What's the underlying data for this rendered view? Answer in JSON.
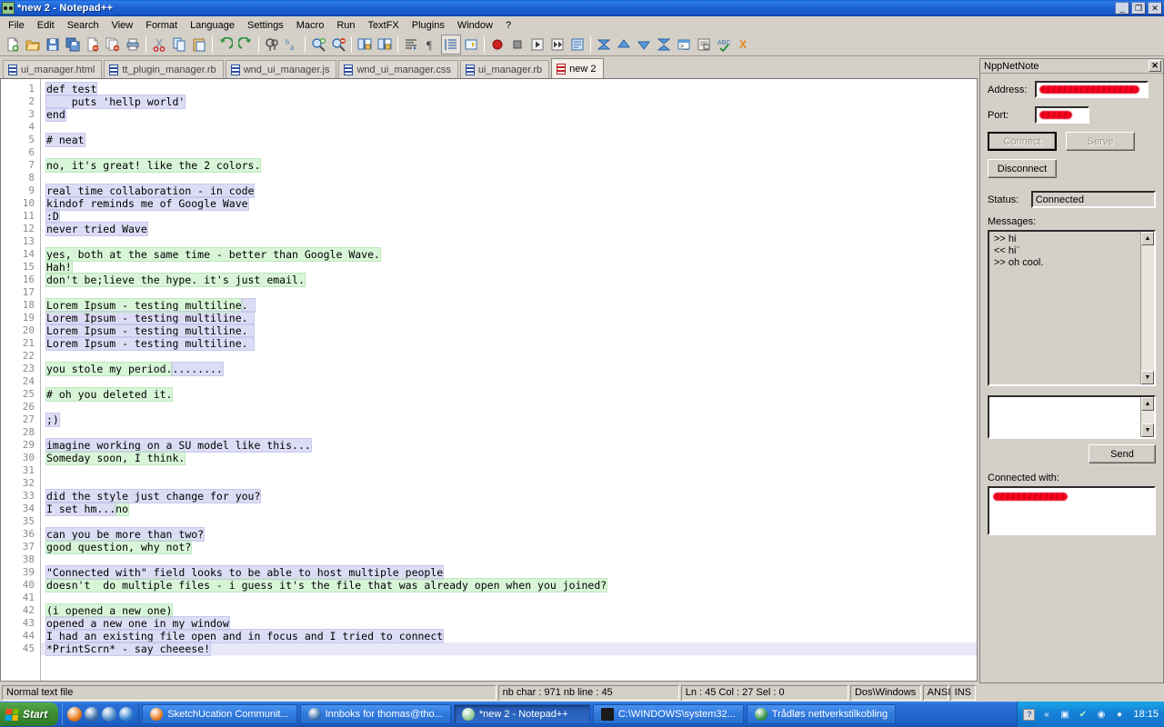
{
  "window": {
    "title": "*new  2 - Notepad++",
    "app_icon": "notepadpp-icon",
    "minimize_label": "_",
    "restore_label": "❐",
    "close_label": "✕"
  },
  "menu": {
    "items": [
      {
        "label": "File"
      },
      {
        "label": "Edit"
      },
      {
        "label": "Search"
      },
      {
        "label": "View"
      },
      {
        "label": "Format"
      },
      {
        "label": "Language"
      },
      {
        "label": "Settings"
      },
      {
        "label": "Macro"
      },
      {
        "label": "Run"
      },
      {
        "label": "TextFX"
      },
      {
        "label": "Plugins"
      },
      {
        "label": "Window"
      },
      {
        "label": "?"
      }
    ]
  },
  "toolbar": {
    "close_doc_label": "X",
    "buttons": [
      {
        "icon": "new-file-icon"
      },
      {
        "icon": "open-folder-icon"
      },
      {
        "icon": "save-icon"
      },
      {
        "icon": "save-all-icon"
      },
      {
        "icon": "close-file-icon"
      },
      {
        "icon": "close-all-icon"
      },
      {
        "icon": "print-icon"
      },
      {
        "sep": true
      },
      {
        "icon": "cut-icon"
      },
      {
        "icon": "copy-icon"
      },
      {
        "icon": "paste-icon"
      },
      {
        "sep": true
      },
      {
        "icon": "undo-icon"
      },
      {
        "icon": "redo-icon"
      },
      {
        "sep": true
      },
      {
        "icon": "find-icon"
      },
      {
        "icon": "replace-icon"
      },
      {
        "sep": true
      },
      {
        "icon": "zoom-in-icon"
      },
      {
        "icon": "zoom-out-icon"
      },
      {
        "sep": true
      },
      {
        "icon": "sync-vertical-icon"
      },
      {
        "icon": "sync-horizontal-icon"
      },
      {
        "sep": true
      },
      {
        "icon": "word-wrap-icon"
      },
      {
        "icon": "show-all-chars-icon"
      },
      {
        "icon": "indent-guide-icon",
        "pressed": true
      },
      {
        "icon": "user-language-icon"
      },
      {
        "sep": true
      },
      {
        "icon": "record-macro-icon"
      },
      {
        "icon": "stop-macro-icon"
      },
      {
        "icon": "play-macro-icon"
      },
      {
        "icon": "play-multiple-macro-icon"
      },
      {
        "icon": "save-macro-icon"
      },
      {
        "sep": true
      },
      {
        "icon": "collapse-all-icon"
      },
      {
        "icon": "fold-up-icon"
      },
      {
        "icon": "unfold-down-icon"
      },
      {
        "icon": "expand-all-icon"
      },
      {
        "icon": "console-icon"
      },
      {
        "icon": "document-map-icon"
      },
      {
        "icon": "spell-check-icon"
      }
    ]
  },
  "tabs": [
    {
      "label": "ui_manager.html",
      "active": false
    },
    {
      "label": "tt_plugin_manager.rb",
      "active": false
    },
    {
      "label": "wnd_ui_manager.js",
      "active": false
    },
    {
      "label": "wnd_ui_manager.css",
      "active": false
    },
    {
      "label": "ui_manager.rb",
      "active": false
    },
    {
      "label": "new  2",
      "active": true
    }
  ],
  "editor": {
    "lines": [
      {
        "n": 1,
        "segs": [
          {
            "t": "def test",
            "h": "lav"
          }
        ]
      },
      {
        "n": 2,
        "segs": [
          {
            "t": "    puts 'hellp world'",
            "h": "lav"
          }
        ]
      },
      {
        "n": 3,
        "segs": [
          {
            "t": "end",
            "h": "lav"
          }
        ]
      },
      {
        "n": 4,
        "segs": []
      },
      {
        "n": 5,
        "segs": [
          {
            "t": "# neat",
            "h": "lav"
          }
        ]
      },
      {
        "n": 6,
        "segs": []
      },
      {
        "n": 7,
        "segs": [
          {
            "t": "no, it's great! like the 2 colors.",
            "h": "grn"
          }
        ]
      },
      {
        "n": 8,
        "segs": []
      },
      {
        "n": 9,
        "segs": [
          {
            "t": "real time collaboration - in code",
            "h": "lav"
          }
        ]
      },
      {
        "n": 10,
        "segs": [
          {
            "t": "kindof reminds me of Google Wave",
            "h": "lav"
          }
        ]
      },
      {
        "n": 11,
        "segs": [
          {
            "t": ":D",
            "h": "lav"
          }
        ]
      },
      {
        "n": 12,
        "segs": [
          {
            "t": "never tried Wave",
            "h": "lav"
          }
        ]
      },
      {
        "n": 13,
        "segs": []
      },
      {
        "n": 14,
        "segs": [
          {
            "t": "yes, both at the same time - better than Google Wave.",
            "h": "grn"
          }
        ]
      },
      {
        "n": 15,
        "segs": [
          {
            "t": "Hah!",
            "h": "grn"
          }
        ]
      },
      {
        "n": 16,
        "segs": [
          {
            "t": "don't be;lieve the hype. it's just email.",
            "h": "grn"
          }
        ]
      },
      {
        "n": 17,
        "segs": []
      },
      {
        "n": 18,
        "segs": [
          {
            "t": "Lorem Ipsum - testing multiline",
            "h": "grn"
          },
          {
            "t": ". ",
            "h": "lav"
          }
        ]
      },
      {
        "n": 19,
        "segs": [
          {
            "t": "Lorem Ipsum - testing multiline. ",
            "h": "lav"
          }
        ]
      },
      {
        "n": 20,
        "segs": [
          {
            "t": "Lorem Ipsum - testing multiline. ",
            "h": "lav"
          }
        ]
      },
      {
        "n": 21,
        "segs": [
          {
            "t": "Lorem Ipsum - testing multiline. ",
            "h": "lav"
          }
        ]
      },
      {
        "n": 22,
        "segs": []
      },
      {
        "n": 23,
        "segs": [
          {
            "t": "you stole my period.",
            "h": "grn"
          },
          {
            "t": "........",
            "h": "lav"
          }
        ]
      },
      {
        "n": 24,
        "segs": []
      },
      {
        "n": 25,
        "segs": [
          {
            "t": "# oh you deleted it.",
            "h": "grn"
          }
        ]
      },
      {
        "n": 26,
        "segs": []
      },
      {
        "n": 27,
        "segs": [
          {
            "t": ";)",
            "h": "lav"
          }
        ]
      },
      {
        "n": 28,
        "segs": []
      },
      {
        "n": 29,
        "segs": [
          {
            "t": "imagine working on a SU model like this...",
            "h": "lav"
          }
        ]
      },
      {
        "n": 30,
        "segs": [
          {
            "t": "Someday soon, I think.",
            "h": "grn"
          }
        ]
      },
      {
        "n": 31,
        "segs": []
      },
      {
        "n": 32,
        "segs": []
      },
      {
        "n": 33,
        "segs": [
          {
            "t": "did the style just change for you?",
            "h": "lav"
          }
        ]
      },
      {
        "n": 34,
        "segs": [
          {
            "t": "I set hm...",
            "h": "lav"
          },
          {
            "t": "no",
            "h": "grn"
          }
        ]
      },
      {
        "n": 35,
        "segs": []
      },
      {
        "n": 36,
        "segs": [
          {
            "t": "can you be more than two?",
            "h": "lav"
          }
        ]
      },
      {
        "n": 37,
        "segs": [
          {
            "t": "good question, why not?",
            "h": "grn"
          }
        ]
      },
      {
        "n": 38,
        "segs": []
      },
      {
        "n": 39,
        "segs": [
          {
            "t": "\"Connected with\" field looks to be able to host multiple people",
            "h": "lav"
          }
        ]
      },
      {
        "n": 40,
        "segs": [
          {
            "t": "doesn't  do multiple files - i guess it's the file that was already open when you joined?",
            "h": "grn"
          }
        ]
      },
      {
        "n": 41,
        "segs": []
      },
      {
        "n": 42,
        "segs": [
          {
            "t": "(i opened a new one)",
            "h": "grn"
          }
        ]
      },
      {
        "n": 43,
        "segs": [
          {
            "t": "opened a new one in my window",
            "h": "lav"
          }
        ]
      },
      {
        "n": 44,
        "segs": [
          {
            "t": "I had an existing file open and in focus and I tried to connect",
            "h": "lav"
          }
        ]
      },
      {
        "n": 45,
        "segs": [
          {
            "t": "*PrintScrn* - say cheeese!",
            "h": "lav"
          }
        ],
        "caret": true
      }
    ]
  },
  "statusbar": {
    "file_type": "Normal text file",
    "counts": "nb char : 971   nb line : 45",
    "position": "Ln : 45   Col : 27   Sel : 0",
    "eol": "Dos\\Windows",
    "encoding": "ANSI",
    "insert_mode": "INS"
  },
  "panel": {
    "title": "NppNetNote",
    "close_label": "✕",
    "address_label": "Address:",
    "address_value": "",
    "port_label": "Port:",
    "port_value": "",
    "connect_label": "Connect",
    "serve_label": "Serve",
    "disconnect_label": "Disconnect",
    "status_label": "Status:",
    "status_value": "Connected",
    "messages_label": "Messages:",
    "messages": [
      ">> hi",
      "<< hi¨",
      ">> oh cool."
    ],
    "input_value": "",
    "send_label": "Send",
    "connected_with_label": "Connected with:",
    "connected_with_value": "",
    "scroll_up": "▲",
    "scroll_down": "▼"
  },
  "taskbar": {
    "start_label": "Start",
    "quick_launch": [
      {
        "icon": "firefox-icon",
        "color": "#e8791b"
      },
      {
        "icon": "thunderbird-icon",
        "color": "#3a6ea8"
      },
      {
        "icon": "media-player-icon",
        "color": "#4a8ac4"
      },
      {
        "icon": "internet-explorer-icon",
        "color": "#2f7fd0"
      }
    ],
    "tasks": [
      {
        "label": "SketchUcation Communit...",
        "icon": "firefox-icon",
        "color": "#e8791b",
        "active": false
      },
      {
        "label": "Innboks for thomas@tho...",
        "icon": "thunderbird-icon",
        "color": "#3a6ea8",
        "active": false
      },
      {
        "label": "*new  2 - Notepad++",
        "icon": "notepadpp-icon",
        "color": "#8fc78f",
        "active": true
      },
      {
        "label": "C:\\WINDOWS\\system32...",
        "icon": "console-icon",
        "color": "#1a1a1a",
        "active": false
      },
      {
        "label": "Trådløs nettverkstilkobling",
        "icon": "wireless-icon",
        "color": "#2f8f3f",
        "active": false
      }
    ],
    "tray": {
      "help_icon": "help-balloon-icon",
      "expand_icon": "chevron-up-icon",
      "icons": [
        "network-icon",
        "shield-update-icon",
        "disc-icon",
        "volume-muted-icon"
      ],
      "clock": "18:15"
    }
  },
  "colors": {
    "titlebar_blue": "#1d63d6",
    "chrome_gray": "#d4d0c8",
    "editor_white": "#ffffff",
    "highlight_lavender": "#dcdcf5",
    "highlight_green": "#d8f5d8",
    "redaction_red": "#f00030",
    "taskbar_blue": "#2368d2",
    "start_green": "#3d8e33"
  }
}
